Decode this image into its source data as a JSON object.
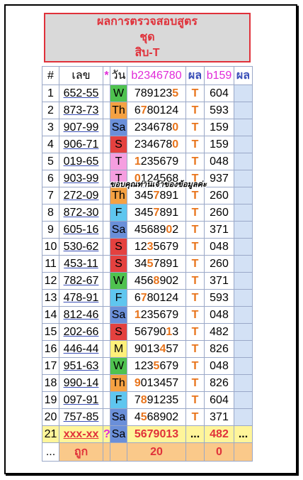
{
  "title": {
    "line1": "ผลการตรวจสอบสูตร",
    "line2": "ชุด",
    "line3": "สิบ-T"
  },
  "headers": {
    "no": "#",
    "lek": "เลข",
    "star": "*",
    "day": "วัน",
    "b1": "b2346780",
    "res1": "ผล",
    "b2": "b159",
    "res2": "ผล"
  },
  "day_colors": {
    "W": "#4fc24f",
    "Th": "#f5a142",
    "Sa": "#6a8fd9",
    "S": "#e4413f",
    "T": "#f59ee0",
    "F": "#5fc6ef",
    "M": "#fff07a"
  },
  "rows": [
    {
      "no": "1",
      "lek": "652-55",
      "day": "W",
      "digits": [
        [
          "78912",
          0
        ],
        [
          "3",
          0
        ],
        [
          "5",
          1
        ]
      ],
      "res": "T",
      "b159": "604"
    },
    {
      "no": "2",
      "lek": "873-73",
      "day": "Th",
      "digits": [
        [
          "6",
          0
        ],
        [
          "7",
          1
        ],
        [
          "80124",
          0
        ]
      ],
      "res": "T",
      "b159": "593"
    },
    {
      "no": "3",
      "lek": "907-99",
      "day": "Sa",
      "digits": [
        [
          "234678",
          0
        ],
        [
          "0",
          1
        ]
      ],
      "res": "T",
      "b159": "159"
    },
    {
      "no": "4",
      "lek": "906-71",
      "day": "S",
      "digits": [
        [
          "234678",
          0
        ],
        [
          "0",
          1
        ]
      ],
      "res": "T",
      "b159": "159"
    },
    {
      "no": "5",
      "lek": "019-65",
      "day": "T",
      "digits": [
        [
          "1",
          1
        ],
        [
          "235679",
          0
        ]
      ],
      "res": "T",
      "b159": "048"
    },
    {
      "no": "6",
      "lek": "903-99",
      "day": "T",
      "digits": [
        [
          "0",
          1
        ],
        [
          "124568",
          0
        ]
      ],
      "res": "T",
      "b159": "937"
    },
    {
      "no": "7",
      "lek": "272-09",
      "day": "Th",
      "digits": [
        [
          "345",
          0
        ],
        [
          "7",
          1
        ],
        [
          "891",
          0
        ]
      ],
      "res": "T",
      "b159": "260"
    },
    {
      "no": "8",
      "lek": "872-30",
      "day": "F",
      "digits": [
        [
          "345",
          0
        ],
        [
          "7",
          1
        ],
        [
          "891",
          0
        ]
      ],
      "res": "T",
      "b159": "260"
    },
    {
      "no": "9",
      "lek": "605-16",
      "day": "Sa",
      "digits": [
        [
          "45689",
          0
        ],
        [
          "0",
          1
        ],
        [
          "2",
          0
        ]
      ],
      "res": "T",
      "b159": "371"
    },
    {
      "no": "10",
      "lek": "530-62",
      "day": "S",
      "digits": [
        [
          "12",
          0
        ],
        [
          "3",
          1
        ],
        [
          "5679",
          0
        ]
      ],
      "res": "T",
      "b159": "048"
    },
    {
      "no": "11",
      "lek": "453-11",
      "day": "S",
      "digits": [
        [
          "34",
          0
        ],
        [
          "5",
          1
        ],
        [
          "7891",
          0
        ]
      ],
      "res": "T",
      "b159": "260"
    },
    {
      "no": "12",
      "lek": "782-67",
      "day": "W",
      "digits": [
        [
          "456",
          0
        ],
        [
          "8",
          1
        ],
        [
          "902",
          0
        ]
      ],
      "res": "T",
      "b159": "371"
    },
    {
      "no": "13",
      "lek": "478-91",
      "day": "F",
      "digits": [
        [
          "6",
          0
        ],
        [
          "7",
          1
        ],
        [
          "80124",
          0
        ]
      ],
      "res": "T",
      "b159": "593"
    },
    {
      "no": "14",
      "lek": "812-46",
      "day": "Sa",
      "digits": [
        [
          "1",
          1
        ],
        [
          "235679",
          0
        ]
      ],
      "res": "T",
      "b159": "048"
    },
    {
      "no": "15",
      "lek": "202-66",
      "day": "S",
      "digits": [
        [
          "56790",
          0
        ],
        [
          "1",
          1
        ],
        [
          "3",
          0
        ]
      ],
      "res": "T",
      "b159": "482"
    },
    {
      "no": "16",
      "lek": "446-44",
      "day": "M",
      "digits": [
        [
          "9013",
          0
        ],
        [
          "4",
          1
        ],
        [
          "57",
          0
        ]
      ],
      "res": "T",
      "b159": "826"
    },
    {
      "no": "17",
      "lek": "951-63",
      "day": "W",
      "digits": [
        [
          "123",
          0
        ],
        [
          "5",
          1
        ],
        [
          "679",
          0
        ]
      ],
      "res": "T",
      "b159": "048"
    },
    {
      "no": "18",
      "lek": "990-14",
      "day": "Th",
      "digits": [
        [
          "9",
          1
        ],
        [
          "013457",
          0
        ]
      ],
      "res": "T",
      "b159": "826"
    },
    {
      "no": "19",
      "lek": "097-91",
      "day": "F",
      "digits": [
        [
          "7",
          0
        ],
        [
          "8",
          1
        ],
        [
          "91235",
          0
        ]
      ],
      "res": "T",
      "b159": "604"
    },
    {
      "no": "20",
      "lek": "757-85",
      "day": "Sa",
      "digits": [
        [
          "4",
          0
        ],
        [
          "5",
          1
        ],
        [
          "68902",
          0
        ]
      ],
      "res": "T",
      "b159": "371"
    }
  ],
  "pending": {
    "no": "21",
    "lek": "xxx-xx",
    "star": "?",
    "day": "Sa",
    "digits": "5679013",
    "res1": "...",
    "b159": "482",
    "res2": "..."
  },
  "footer": {
    "dots": "...",
    "label": "ถูก",
    "count1": "20",
    "count2": "0"
  },
  "watermark": "ขอบคุณท่านเจ้าของข้อมูลค่ะ"
}
